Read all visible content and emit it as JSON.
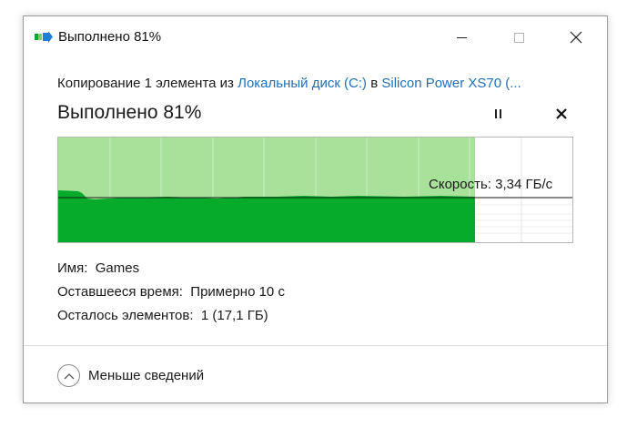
{
  "window": {
    "title": "Выполнено 81%"
  },
  "dialog": {
    "source_prefix": "Копирование 1 элемента из ",
    "source_name": "Локальный диск (C:)",
    "source_middle": " в ",
    "destination_name": "Silicon Power XS70 (...",
    "heading": "Выполнено 81%",
    "progress_percent": 81,
    "speed_label": "Скорость: 3,34 ГБ/с"
  },
  "details": {
    "name_label": "Имя:",
    "name_value": "Games",
    "time_label": "Оставшееся время:",
    "time_value": "Примерно 10 с",
    "items_label": "Осталось элементов:",
    "items_value": "1 (17,1 ГБ)"
  },
  "footer": {
    "fewer_details_label": "Меньше сведений"
  },
  "icons": {
    "app": "copy-progress-icon",
    "minimize": "minimize-icon",
    "maximize": "maximize-icon",
    "close": "close-icon",
    "pause": "pause-icon",
    "cancel": "cancel-icon",
    "chevron": "chevron-up-icon"
  },
  "colors": {
    "progress_fill": "#a8e29a",
    "speed_fill": "#06ab2b",
    "link": "#1f6fb5"
  }
}
